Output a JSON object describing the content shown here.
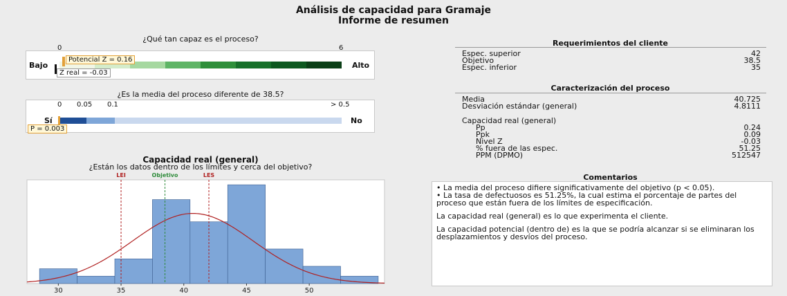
{
  "report": {
    "title": "Análisis de capacidad para Gramaje",
    "subtitle": "Informe de resumen"
  },
  "capability_panel": {
    "heading": "¿Qué tan capaz es el proceso?",
    "scale_min": "0",
    "scale_max": "6",
    "low_label": "Bajo",
    "high_label": "Alto",
    "potential_label": "Potencial Z = 0.16",
    "actual_label": "Z real = -0.03",
    "potential_z": 0.16,
    "actual_z": -0.03
  },
  "mean_panel": {
    "heading": "¿Es la media del proceso diferente de 38.5?",
    "ticks": [
      "0",
      "0.05",
      "0.1",
      "> 0.5"
    ],
    "yes_label": "Sí",
    "no_label": "No",
    "p_label": "P = 0.003",
    "p_value": 0.003
  },
  "histogram_panel": {
    "title": "Capacidad real (general)",
    "subtitle": "¿Están los datos dentro de los límites y cerca del objetivo?",
    "ref_labels": {
      "lei": "LEI",
      "target": "Objetivo",
      "les": "LES"
    }
  },
  "requirements": {
    "heading": "Requerimientos del cliente",
    "rows": [
      {
        "label": "Espec. superior",
        "value": "42"
      },
      {
        "label": "Objetivo",
        "value": "38.5"
      },
      {
        "label": "Espec. inferior",
        "value": "35"
      }
    ]
  },
  "characterization": {
    "heading": "Caracterización del proceso",
    "rows": [
      {
        "label": "Media",
        "value": "40.725"
      },
      {
        "label": "Desviación estándar (general)",
        "value": "4.8111"
      }
    ],
    "capability_heading": "Capacidad real (general)",
    "capability_rows": [
      {
        "label": "Pp",
        "value": "0.24"
      },
      {
        "label": "Ppk",
        "value": "0.09"
      },
      {
        "label": "Nivel Z",
        "value": "-0.03"
      },
      {
        "label": "% fuera de las espec.",
        "value": "51.25"
      },
      {
        "label": "PPM (DPMO)",
        "value": "512547"
      }
    ]
  },
  "comments": {
    "heading": "Comentarios",
    "bullet1": "•  La media del proceso difiere significativamente del objetivo (p < 0.05).",
    "bullet2": "•  La tasa de defectuosos es 51.25%, la cual estima el porcentaje de partes del proceso que están fuera de los límites de especificación.",
    "para1": "La capacidad real (general) es lo que experimenta el cliente.",
    "para2": "La capacidad potencial (dentro de) es la que se podría alcanzar si se eliminaran los desplazamientos y desvíos del proceso."
  },
  "colors": {
    "bar_fill": "#7ea6d8",
    "bar_stroke": "#3d5f8f",
    "curve": "#b02020",
    "spec_line": "#b02020",
    "target_line": "#2e8b3a",
    "p_bar_dark": "#1f4e96"
  },
  "chart_data": {
    "type": "bar",
    "title": "Capacidad real (general)",
    "xlabel": "",
    "ylabel": "",
    "bins": [
      {
        "from": 28.5,
        "to": 31.5,
        "height": 3
      },
      {
        "from": 31.5,
        "to": 34.5,
        "height": 1.5
      },
      {
        "from": 34.5,
        "to": 37.5,
        "height": 5
      },
      {
        "from": 37.5,
        "to": 40.5,
        "height": 17
      },
      {
        "from": 40.5,
        "to": 43.5,
        "height": 12.5
      },
      {
        "from": 43.5,
        "to": 46.5,
        "height": 20
      },
      {
        "from": 46.5,
        "to": 49.5,
        "height": 7
      },
      {
        "from": 49.5,
        "to": 52.5,
        "height": 3.5
      },
      {
        "from": 52.5,
        "to": 55.5,
        "height": 1.5
      }
    ],
    "x_ticks": [
      30,
      35,
      40,
      45,
      50
    ],
    "xlim": [
      27.5,
      56
    ],
    "ylim": [
      0,
      21
    ],
    "reference_lines": {
      "LEI": 35,
      "Objetivo": 38.5,
      "LES": 42
    },
    "normal_fit": {
      "mean": 40.725,
      "sd": 4.8111,
      "peak": 14.2
    },
    "grid": false
  }
}
